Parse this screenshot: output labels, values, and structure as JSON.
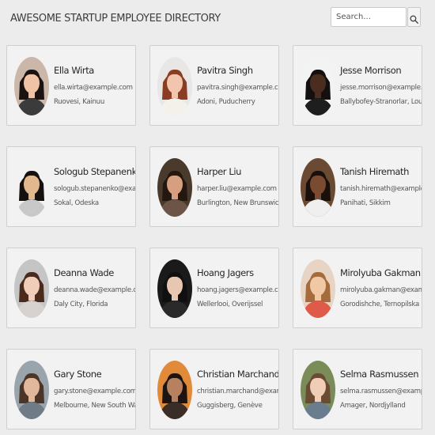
{
  "header": {
    "title": "AWESOME STARTUP EMPLOYEE DIRECTORY"
  },
  "search": {
    "placeholder": "Search...",
    "button_icon": "search-icon"
  },
  "employees": [
    {
      "name": "Ella Wirta",
      "email": "ella.wirta@example.com",
      "location": "Ruovesi, Kainuu",
      "avatar": {
        "bg": "#cbb7a9",
        "skin": "#f0c3a6",
        "hair": "#1b1311",
        "shirt": "#3b3b3b"
      }
    },
    {
      "name": "Pavitra Singh",
      "email": "pavitra.singh@example.com",
      "location": "Adoni, Puducherry",
      "avatar": {
        "bg": "#e9e7e5",
        "skin": "#f2c6ae",
        "hair": "#8a3d22",
        "shirt": "#f4f0ea"
      }
    },
    {
      "name": "Jesse Morrison",
      "email": "jesse.morrison@example.com",
      "location": "Ballybofey-Stranorlar, Louth",
      "avatar": {
        "bg": "#f3f3f3",
        "skin": "#4a2d1f",
        "hair": "#141010",
        "shirt": "#1e1e1e"
      }
    },
    {
      "name": "Sologub Stepanenko",
      "email": "sologub.stepanenko@example.com",
      "location": "Sokal, Odeska",
      "avatar": {
        "bg": "#f2f2f2",
        "skin": "#e2b98f",
        "hair": "#15110f",
        "shirt": "#c8c8c8"
      }
    },
    {
      "name": "Harper Liu",
      "email": "harper.liu@example.com",
      "location": "Burlington, New Brunswick",
      "avatar": {
        "bg": "#4a3a2c",
        "skin": "#d59f80",
        "hair": "#24170f",
        "shirt": "#6c5546"
      }
    },
    {
      "name": "Tanish Hiremath",
      "email": "tanish.hiremath@example.com",
      "location": "Panihati, Sikkim",
      "avatar": {
        "bg": "#6b4a33",
        "skin": "#7a4b30",
        "hair": "#1a100b",
        "shirt": "#efefef"
      }
    },
    {
      "name": "Deanna Wade",
      "email": "deanna.wade@example.com",
      "location": "Daly City, Florida",
      "avatar": {
        "bg": "#c5c5c5",
        "skin": "#efcdb8",
        "hair": "#4b2a1e",
        "shirt": "#d7d2cf"
      }
    },
    {
      "name": "Hoang Jagers",
      "email": "hoang.jagers@example.com",
      "location": "Wellerlooi, Overijssel",
      "avatar": {
        "bg": "#1a1a1a",
        "skin": "#e8c7b2",
        "hair": "#101010",
        "shirt": "#2a2a2a"
      }
    },
    {
      "name": "Mirolyuba Gakman",
      "email": "mirolyuba.gakman@example.com",
      "location": "Gorodishche, Ternopilska",
      "avatar": {
        "bg": "#e8d4c4",
        "skin": "#f1c8a6",
        "hair": "#a66b3a",
        "shirt": "#e05a4a"
      }
    },
    {
      "name": "Gary Stone",
      "email": "gary.stone@example.com",
      "location": "Melbourne, New South Wales",
      "avatar": {
        "bg": "#9aa4ac",
        "skin": "#e2b89c",
        "hair": "#4a3526",
        "shirt": "#6f7b86"
      }
    },
    {
      "name": "Christian Marchand",
      "email": "christian.marchand@example.com",
      "location": "Guggisberg, Genève",
      "avatar": {
        "bg": "#e08a3a",
        "skin": "#b78160",
        "hair": "#1c1410",
        "shirt": "#3a2d27"
      }
    },
    {
      "name": "Selma Rasmussen",
      "email": "selma.rasmussen@example.com",
      "location": "Amager, Nordjylland",
      "avatar": {
        "bg": "#7a8c5a",
        "skin": "#f0cdb6",
        "hair": "#6b4b33",
        "shirt": "#6a7d8f"
      }
    }
  ]
}
